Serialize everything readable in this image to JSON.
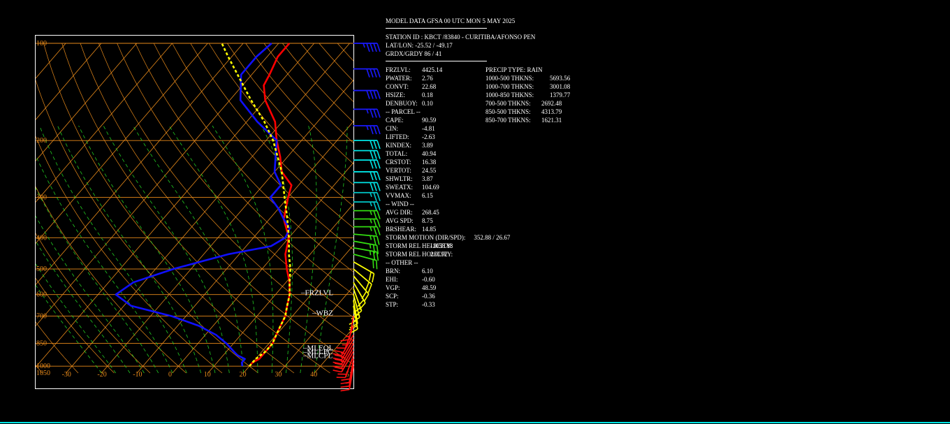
{
  "header": {
    "title": "MODEL DATA GFSA 00 UTC MON 5 MAY 2025",
    "station": "STATION ID : KBCT /83840 - CURITIBA/AFONSO PEN",
    "latlon": "LAT/LON: -25.52 / -49.17",
    "grid": "GRDX/GRDY 86 / 41"
  },
  "indices_left": [
    {
      "label": "FRZLVL:",
      "value": "4425.14"
    },
    {
      "label": "PWATER:",
      "value": "2.76"
    },
    {
      "label": "CONVT:",
      "value": "22.68"
    },
    {
      "label": "HSIZE:",
      "value": "0.18"
    },
    {
      "label": "DENBUOY:",
      "value": "0.10"
    },
    {
      "label": "-- PARCEL --",
      "value": ""
    },
    {
      "label": "CAPE:",
      "value": "90.59"
    },
    {
      "label": "CIN:",
      "value": "-4.81"
    },
    {
      "label": "LIFTED:",
      "value": "-2.63"
    },
    {
      "label": "KINDEX:",
      "value": "3.89"
    },
    {
      "label": "TOTAL:",
      "value": "40.94"
    },
    {
      "label": "CRSTOT:",
      "value": "16.38"
    },
    {
      "label": "VERTOT:",
      "value": "24.55"
    },
    {
      "label": "SHWLTR:",
      "value": "3.87"
    },
    {
      "label": "SWEATX:",
      "value": "104.69"
    },
    {
      "label": "VVMAX:",
      "value": "6.15"
    },
    {
      "label": "-- WIND --",
      "value": ""
    },
    {
      "label": "AVG DIR:",
      "value": "268.45"
    },
    {
      "label": "AVG SPD:",
      "value": "8.75"
    },
    {
      "label": "BRSHEAR:",
      "value": "14.85"
    },
    {
      "label": "STORM MOTION (DIR/SPD):",
      "value": "352.88 / 26.67"
    },
    {
      "label": "STORM REL HELICITY:",
      "value": "-1058.88"
    },
    {
      "label": "STORM REL HOLICITY:",
      "value": "283.92"
    },
    {
      "label": "-- OTHER --",
      "value": ""
    },
    {
      "label": "BRN:",
      "value": "6.10"
    },
    {
      "label": "EHI:",
      "value": "-0.60"
    },
    {
      "label": "VGP:",
      "value": "48.59"
    },
    {
      "label": "SCP:",
      "value": "-0.36"
    },
    {
      "label": "STP:",
      "value": "-0.33"
    }
  ],
  "indices_right": [
    {
      "label": "PRECIP TYPE: RAIN",
      "value": ""
    },
    {
      "label": "1000-500 THKNS:",
      "value": "5693.56"
    },
    {
      "label": "1000-700 THKNS:",
      "value": "3001.08"
    },
    {
      "label": "1000-850 THKNS:",
      "value": "1379.77"
    },
    {
      "label": "700-500 THKNS:",
      "value": "2692.48"
    },
    {
      "label": "850-500 THKNS:",
      "value": "4313.79"
    },
    {
      "label": "850-700 THKNS:",
      "value": "1621.31"
    }
  ],
  "colors": {
    "isobar": "#e88a1a",
    "dry_adiabat": "#e88a1a",
    "moist_adiabat": "#22cc22",
    "temperature": "#ff0000",
    "dewpoint": "#1010ff",
    "parcel": "#ffff00",
    "frame": "#ffffff",
    "bottom_line": "#00e5e5"
  },
  "chart_data": {
    "type": "line",
    "title": "",
    "xlabel": "",
    "ylabel": "",
    "y_scale": "log",
    "ylim": [
      1050,
      100
    ],
    "xlim": [
      -35,
      55
    ],
    "pressure_ticks": [
      "100",
      "200",
      "300",
      "400",
      "500",
      "600",
      "700",
      "850",
      "1000",
      "1050"
    ],
    "temperature_ticks": [
      "-30",
      "-20",
      "-10",
      "0",
      "10",
      "20",
      "30",
      "40",
      "5"
    ],
    "level_markers": [
      "FRZLVL",
      "WBZ",
      "MLEQL",
      "MLLFC",
      "MLCPL"
    ],
    "series": [
      {
        "name": "",
        "values": [
          [
            1000,
            20
          ],
          [
            975,
            20
          ],
          [
            950,
            21
          ],
          [
            925,
            21
          ],
          [
            900,
            21
          ],
          [
            850,
            21
          ],
          [
            800,
            20
          ],
          [
            750,
            19
          ],
          [
            700,
            18
          ],
          [
            650,
            16
          ],
          [
            600,
            14
          ],
          [
            550,
            11
          ],
          [
            500,
            7
          ],
          [
            450,
            3
          ],
          [
            400,
            0
          ],
          [
            350,
            -6
          ],
          [
            300,
            -10
          ],
          [
            275,
            -12
          ],
          [
            250,
            -18
          ],
          [
            225,
            -22
          ],
          [
            200,
            -27
          ],
          [
            175,
            -32
          ],
          [
            150,
            -40
          ],
          [
            135,
            -44
          ],
          [
            125,
            -45
          ],
          [
            110,
            -47
          ],
          [
            100,
            -47
          ]
        ]
      },
      {
        "name": "",
        "values": [
          [
            1000,
            18
          ],
          [
            975,
            17
          ],
          [
            950,
            17
          ],
          [
            925,
            14
          ],
          [
            900,
            12
          ],
          [
            850,
            8
          ],
          [
            800,
            3
          ],
          [
            750,
            -4
          ],
          [
            700,
            -14
          ],
          [
            650,
            -28
          ],
          [
            600,
            -35
          ],
          [
            550,
            -33
          ],
          [
            500,
            -25
          ],
          [
            450,
            -13
          ],
          [
            425,
            -3
          ],
          [
            400,
            -1
          ],
          [
            375,
            -2
          ],
          [
            350,
            -6
          ],
          [
            325,
            -10
          ],
          [
            300,
            -15
          ],
          [
            275,
            -15
          ],
          [
            250,
            -20
          ],
          [
            200,
            -27
          ],
          [
            175,
            -37
          ],
          [
            150,
            -47
          ],
          [
            125,
            -53
          ],
          [
            110,
            -53
          ],
          [
            100,
            -52
          ]
        ]
      },
      {
        "name": "",
        "values": [
          [
            1000,
            20
          ],
          [
            950,
            20
          ],
          [
            900,
            21
          ],
          [
            850,
            21
          ],
          [
            800,
            20
          ],
          [
            750,
            19
          ],
          [
            700,
            18
          ],
          [
            650,
            16
          ],
          [
            600,
            14
          ],
          [
            550,
            11
          ],
          [
            500,
            8
          ],
          [
            450,
            4
          ],
          [
            400,
            0
          ],
          [
            350,
            -5
          ],
          [
            300,
            -11
          ],
          [
            250,
            -18
          ],
          [
            200,
            -28
          ],
          [
            175,
            -35
          ],
          [
            150,
            -44
          ],
          [
            125,
            -54
          ],
          [
            110,
            -61
          ],
          [
            100,
            -66
          ]
        ]
      }
    ],
    "wind_barbs": [
      {
        "pressure": 100,
        "dir": 270,
        "spd": 45
      },
      {
        "pressure": 120,
        "dir": 270,
        "spd": 40
      },
      {
        "pressure": 140,
        "dir": 270,
        "spd": 40
      },
      {
        "pressure": 160,
        "dir": 270,
        "spd": 35
      },
      {
        "pressure": 180,
        "dir": 270,
        "spd": 35
      },
      {
        "pressure": 200,
        "dir": 270,
        "spd": 30
      },
      {
        "pressure": 215,
        "dir": 270,
        "spd": 30
      },
      {
        "pressure": 230,
        "dir": 270,
        "spd": 30
      },
      {
        "pressure": 250,
        "dir": 270,
        "spd": 30
      },
      {
        "pressure": 270,
        "dir": 270,
        "spd": 30
      },
      {
        "pressure": 290,
        "dir": 270,
        "spd": 25
      },
      {
        "pressure": 310,
        "dir": 270,
        "spd": 25
      },
      {
        "pressure": 330,
        "dir": 270,
        "spd": 25
      },
      {
        "pressure": 350,
        "dir": 270,
        "spd": 25
      },
      {
        "pressure": 370,
        "dir": 270,
        "spd": 25
      },
      {
        "pressure": 390,
        "dir": 275,
        "spd": 25
      },
      {
        "pressure": 410,
        "dir": 280,
        "spd": 25
      },
      {
        "pressure": 430,
        "dir": 280,
        "spd": 25
      },
      {
        "pressure": 450,
        "dir": 285,
        "spd": 20
      },
      {
        "pressure": 475,
        "dir": 300,
        "spd": 20
      },
      {
        "pressure": 500,
        "dir": 310,
        "spd": 20
      },
      {
        "pressure": 525,
        "dir": 320,
        "spd": 20
      },
      {
        "pressure": 550,
        "dir": 330,
        "spd": 20
      },
      {
        "pressure": 575,
        "dir": 340,
        "spd": 20
      },
      {
        "pressure": 600,
        "dir": 345,
        "spd": 20
      },
      {
        "pressure": 625,
        "dir": 350,
        "spd": 20
      },
      {
        "pressure": 650,
        "dir": 350,
        "spd": 20
      },
      {
        "pressure": 700,
        "dir": 10,
        "spd": 15
      },
      {
        "pressure": 750,
        "dir": 20,
        "spd": 15
      },
      {
        "pressure": 800,
        "dir": 30,
        "spd": 20
      },
      {
        "pressure": 825,
        "dir": 30,
        "spd": 25
      },
      {
        "pressure": 850,
        "dir": 30,
        "spd": 25
      },
      {
        "pressure": 875,
        "dir": 30,
        "spd": 25
      },
      {
        "pressure": 900,
        "dir": 30,
        "spd": 20
      },
      {
        "pressure": 925,
        "dir": 20,
        "spd": 20
      },
      {
        "pressure": 950,
        "dir": 10,
        "spd": 20
      },
      {
        "pressure": 975,
        "dir": 10,
        "spd": 15
      },
      {
        "pressure": 1000,
        "dir": 10,
        "spd": 15
      }
    ]
  }
}
